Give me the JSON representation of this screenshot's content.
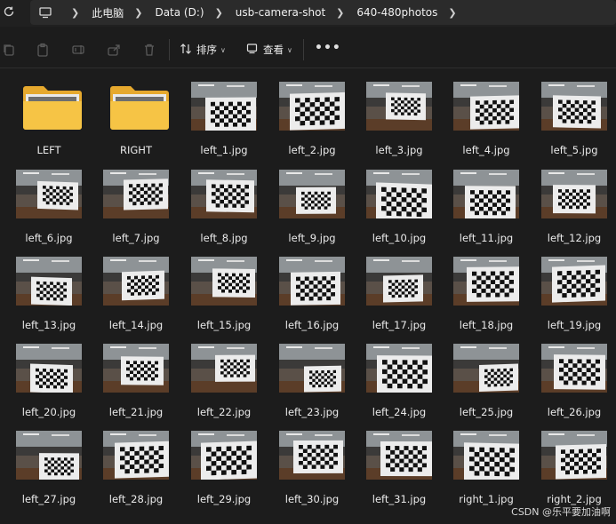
{
  "address": {
    "crumbs": [
      "此电脑",
      "Data (D:)",
      "usb-camera-shot",
      "640-480photos"
    ]
  },
  "toolbar": {
    "sort_label": "排序",
    "view_label": "查看",
    "more_label": "•••"
  },
  "files": [
    {
      "name": "LEFT",
      "type": "folder"
    },
    {
      "name": "RIGHT",
      "type": "folder"
    },
    {
      "name": "left_1.jpg",
      "type": "image"
    },
    {
      "name": "left_2.jpg",
      "type": "image"
    },
    {
      "name": "left_3.jpg",
      "type": "image"
    },
    {
      "name": "left_4.jpg",
      "type": "image"
    },
    {
      "name": "left_5.jpg",
      "type": "image"
    },
    {
      "name": "left_6.jpg",
      "type": "image"
    },
    {
      "name": "left_7.jpg",
      "type": "image"
    },
    {
      "name": "left_8.jpg",
      "type": "image"
    },
    {
      "name": "left_9.jpg",
      "type": "image"
    },
    {
      "name": "left_10.jpg",
      "type": "image"
    },
    {
      "name": "left_11.jpg",
      "type": "image"
    },
    {
      "name": "left_12.jpg",
      "type": "image"
    },
    {
      "name": "left_13.jpg",
      "type": "image"
    },
    {
      "name": "left_14.jpg",
      "type": "image"
    },
    {
      "name": "left_15.jpg",
      "type": "image"
    },
    {
      "name": "left_16.jpg",
      "type": "image"
    },
    {
      "name": "left_17.jpg",
      "type": "image"
    },
    {
      "name": "left_18.jpg",
      "type": "image"
    },
    {
      "name": "left_19.jpg",
      "type": "image"
    },
    {
      "name": "left_20.jpg",
      "type": "image"
    },
    {
      "name": "left_21.jpg",
      "type": "image"
    },
    {
      "name": "left_22.jpg",
      "type": "image"
    },
    {
      "name": "left_23.jpg",
      "type": "image"
    },
    {
      "name": "left_24.jpg",
      "type": "image"
    },
    {
      "name": "left_25.jpg",
      "type": "image"
    },
    {
      "name": "left_26.jpg",
      "type": "image"
    },
    {
      "name": "left_27.jpg",
      "type": "image"
    },
    {
      "name": "left_28.jpg",
      "type": "image"
    },
    {
      "name": "left_29.jpg",
      "type": "image"
    },
    {
      "name": "left_30.jpg",
      "type": "image"
    },
    {
      "name": "left_31.jpg",
      "type": "image"
    },
    {
      "name": "right_1.jpg",
      "type": "image"
    },
    {
      "name": "right_2.jpg",
      "type": "image"
    }
  ],
  "watermark": "CSDN @乐平要加油啊",
  "colors": {
    "background": "#1c1c1c",
    "folder_yellow": "#f6c445"
  }
}
